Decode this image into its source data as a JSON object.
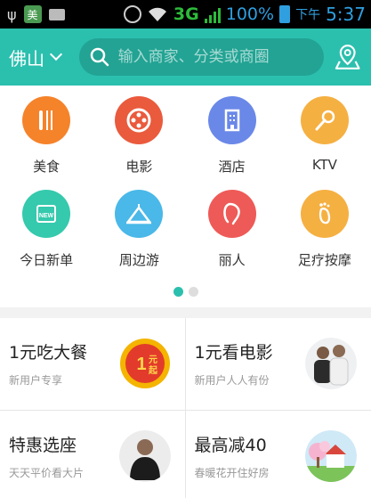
{
  "status_bar": {
    "mei_badge": "美",
    "network": "3G",
    "battery": "100%",
    "time_label": "下午",
    "time": "5:37"
  },
  "header": {
    "city": "佛山",
    "search_placeholder": "输入商家、分类或商圈",
    "accent_color": "#2bbfae"
  },
  "categories": [
    {
      "label": "美食",
      "icon": "fork-knife-icon",
      "color": "#f5832a"
    },
    {
      "label": "电影",
      "icon": "film-reel-icon",
      "color": "#ea5a3d"
    },
    {
      "label": "酒店",
      "icon": "building-icon",
      "color": "#6a88e8"
    },
    {
      "label": "KTV",
      "icon": "microphone-icon",
      "color": "#f5b042"
    },
    {
      "label": "今日新单",
      "icon": "new-badge-icon",
      "color": "#35c9ad"
    },
    {
      "label": "周边游",
      "icon": "tent-icon",
      "color": "#4ab8e8"
    },
    {
      "label": "丽人",
      "icon": "woman-face-icon",
      "color": "#ee5a57"
    },
    {
      "label": "足疗按摩",
      "icon": "footprint-icon",
      "color": "#f5b042"
    }
  ],
  "pager": {
    "count": 2,
    "active": 0
  },
  "deals": [
    {
      "title": "1元吃大餐",
      "subtitle": "新用户专享",
      "badge_text": "1元起"
    },
    {
      "title": "1元看电影",
      "subtitle": "新用户人人有份"
    },
    {
      "title": "特惠选座",
      "subtitle": "天天平价看大片"
    },
    {
      "title": "最高减40",
      "subtitle": "春暖花开住好房"
    }
  ]
}
